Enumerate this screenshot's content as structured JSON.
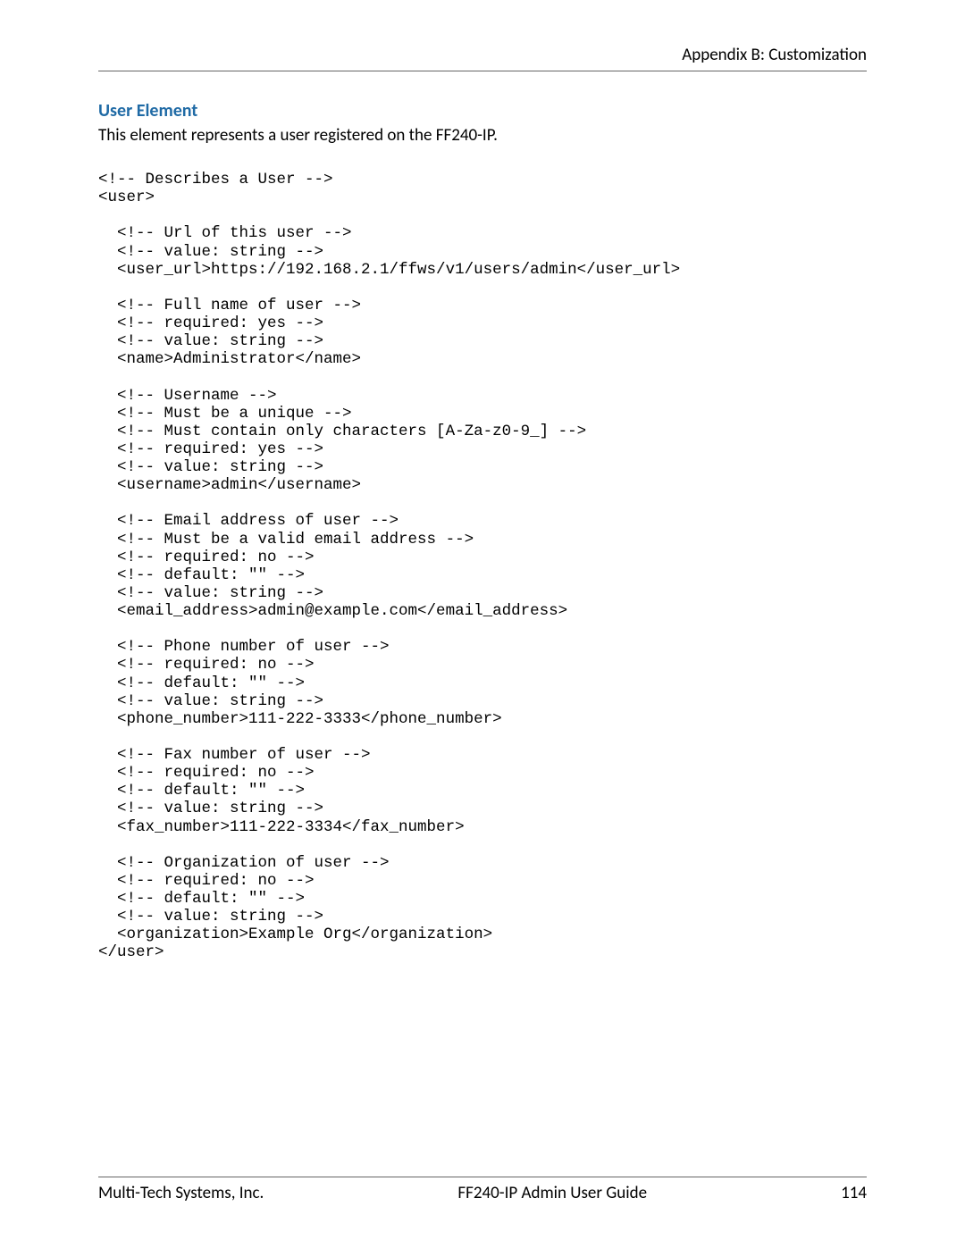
{
  "header": {
    "running_head": "Appendix B: Customization"
  },
  "section": {
    "title": "User Element",
    "intro": "This element represents a user registered on the FF240-IP."
  },
  "code": "<!-- Describes a User -->\n<user>\n\n  <!-- Url of this user -->\n  <!-- value: string -->\n  <user_url>https://192.168.2.1/ffws/v1/users/admin</user_url>\n\n  <!-- Full name of user -->\n  <!-- required: yes -->\n  <!-- value: string -->\n  <name>Administrator</name>\n\n  <!-- Username -->\n  <!-- Must be a unique -->\n  <!-- Must contain only characters [A-Za-z0-9_] -->\n  <!-- required: yes -->\n  <!-- value: string -->\n  <username>admin</username>\n\n  <!-- Email address of user -->\n  <!-- Must be a valid email address -->\n  <!-- required: no -->\n  <!-- default: \"\" -->\n  <!-- value: string -->\n  <email_address>admin@example.com</email_address>\n\n  <!-- Phone number of user -->\n  <!-- required: no -->\n  <!-- default: \"\" -->\n  <!-- value: string -->\n  <phone_number>111-222-3333</phone_number>\n\n  <!-- Fax number of user -->\n  <!-- required: no -->\n  <!-- default: \"\" -->\n  <!-- value: string -->\n  <fax_number>111-222-3334</fax_number>\n\n  <!-- Organization of user -->\n  <!-- required: no -->\n  <!-- default: \"\" -->\n  <!-- value: string -->\n  <organization>Example Org</organization>\n</user>",
  "footer": {
    "left": "Multi-Tech Systems, Inc.",
    "center": "FF240-IP Admin User Guide",
    "right": "114"
  }
}
